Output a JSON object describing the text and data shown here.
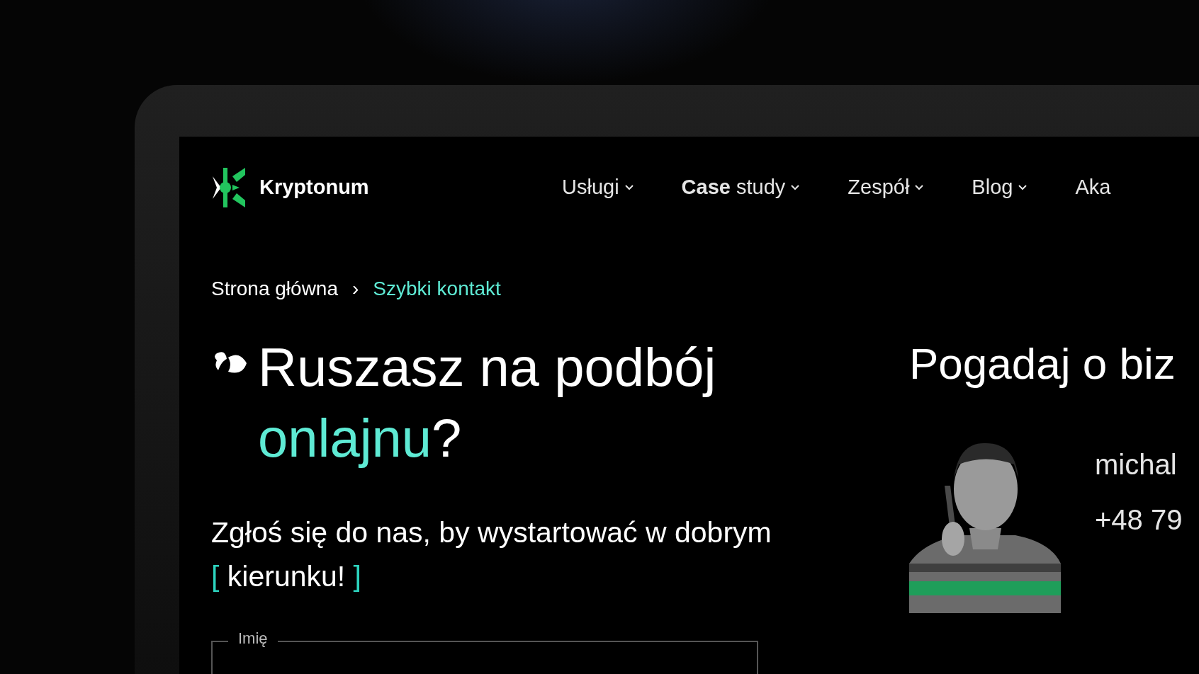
{
  "brand": {
    "name": "Kryptonum"
  },
  "nav": [
    {
      "label": "Usługi",
      "dropdown": true
    },
    {
      "label": "**Case** study",
      "dropdown": true
    },
    {
      "label": "Zespół",
      "dropdown": true
    },
    {
      "label": "Blog",
      "dropdown": true
    },
    {
      "label": "Aka",
      "dropdown": false
    }
  ],
  "breadcrumb": [
    {
      "label": "Strona główna",
      "current": false
    },
    {
      "label": "Szybki kontakt",
      "current": true
    }
  ],
  "breadcrumb_separator": "›",
  "heading": {
    "text": "Ruszasz na podbój",
    "highlight": "onlajnu",
    "suffix": "?"
  },
  "intro": {
    "text": "Zgłoś się do nas, by wystartować w dobrym",
    "open": "[",
    "highlight": "kierunku!",
    "close": "]"
  },
  "form": {
    "fields": [
      {
        "label": "Imię"
      }
    ]
  },
  "contact": {
    "title": "Pogadaj o biz",
    "email": "michal",
    "phone": "+48 79"
  }
}
